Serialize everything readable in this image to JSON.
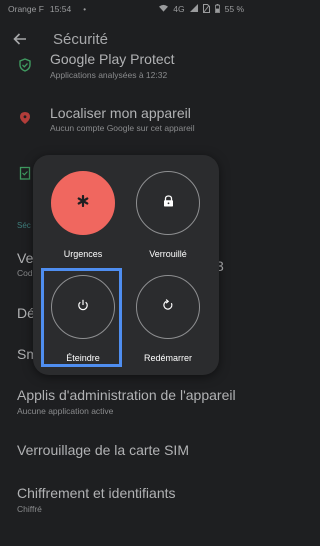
{
  "status_bar": {
    "carrier": "Orange F",
    "time": "15:54",
    "network": "4G",
    "battery": "55 %"
  },
  "header": {
    "title": "Sécurité"
  },
  "settings": [
    {
      "title": "Google Play Protect",
      "subtitle": "Applications analysées à 12:32",
      "icon": "shield-icon"
    },
    {
      "title": "Localiser mon appareil",
      "subtitle": "Aucun compte Google sur cet appareil",
      "icon": "location-pin-icon"
    }
  ],
  "partial_fragments": {
    "section_header": "Séc",
    "item_ve": "Ve",
    "item_ve_sub": "Cod",
    "item_ve_right": "3",
    "item_de": "Dé",
    "item_sm": "Sm"
  },
  "settings_lower": [
    {
      "title": "Applis d'administration de l'appareil",
      "subtitle": "Aucune application active"
    },
    {
      "title": "Verrouillage de la carte SIM",
      "subtitle": ""
    },
    {
      "title": "Chiffrement et identifiants",
      "subtitle": "Chiffré"
    }
  ],
  "power_menu": {
    "emergency": {
      "label": "Urgences",
      "icon": "asterisk-icon",
      "color": "#f0675f"
    },
    "lockdown": {
      "label": "Verrouillé",
      "icon": "lock-icon"
    },
    "power_off": {
      "label": "Éteindre",
      "icon": "power-icon"
    },
    "restart": {
      "label": "Redémarrer",
      "icon": "restart-icon"
    }
  },
  "focus_color": "#4f8ef0"
}
